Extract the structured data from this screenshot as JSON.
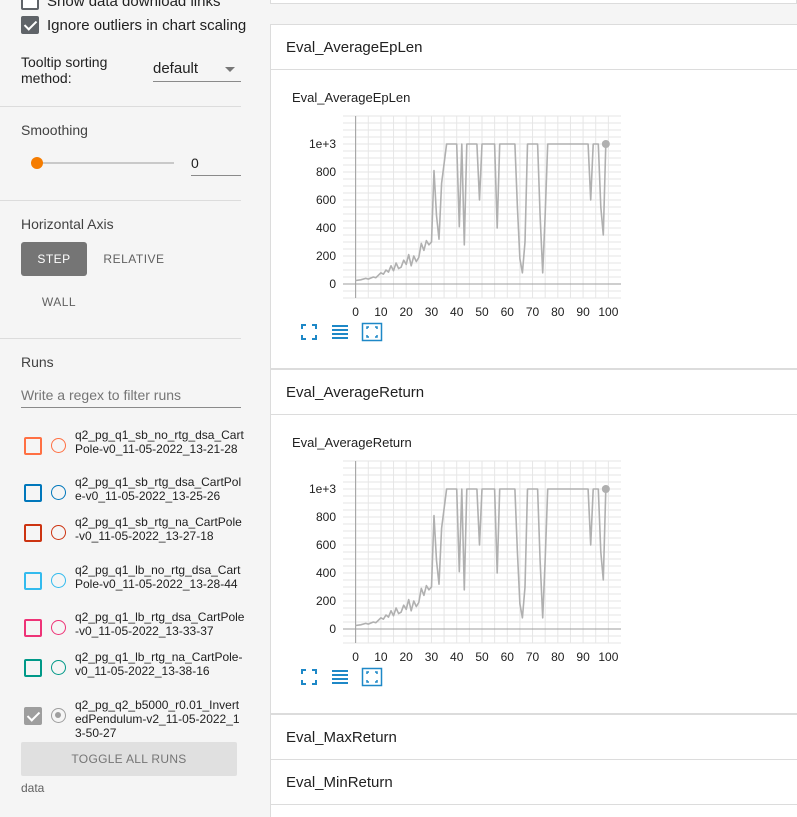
{
  "sidebar": {
    "show_download_links": "Show data download links",
    "ignore_outliers": "Ignore outliers in chart scaling",
    "tooltip_label": "Tooltip sorting method:",
    "tooltip_value": "default",
    "smoothing_title": "Smoothing",
    "smoothing_value": "0",
    "smoothing_level": 0,
    "haxis_title": "Horizontal Axis",
    "haxis_step": "STEP",
    "haxis_relative": "RELATIVE",
    "haxis_wall": "WALL",
    "haxis_selected": "STEP",
    "runs_title": "Runs",
    "runs_filter_placeholder": "Write a regex to filter runs",
    "runs": [
      {
        "name": "q2_pg_q1_sb_no_rtg_dsa_CartPole-v0_11-05-2022_13-21-28",
        "color": "#ff7043",
        "checked": false
      },
      {
        "name": "q2_pg_q1_sb_rtg_dsa_CartPole-v0_11-05-2022_13-25-26",
        "color": "#0077bb",
        "checked": false
      },
      {
        "name": "q2_pg_q1_sb_rtg_na_CartPole-v0_11-05-2022_13-27-18",
        "color": "#cc3311",
        "checked": false
      },
      {
        "name": "q2_pg_q1_lb_no_rtg_dsa_CartPole-v0_11-05-2022_13-28-44",
        "color": "#33bbee",
        "checked": false
      },
      {
        "name": "q2_pg_q1_lb_rtg_dsa_CartPole-v0_11-05-2022_13-33-37",
        "color": "#ee3377",
        "checked": false
      },
      {
        "name": "q2_pg_q1_lb_rtg_na_CartPole-v0_11-05-2022_13-38-16",
        "color": "#009988",
        "checked": false
      },
      {
        "name": "q2_pg_q2_b5000_r0.01_InvertedPendulum-v2_11-05-2022_13-50-27",
        "color": "#9e9e9e",
        "checked": true
      }
    ],
    "toggle_all": "TOGGLE ALL RUNS",
    "data_label": "data"
  },
  "main": {
    "sections": [
      "Eval_AverageEpLen",
      "Eval_AverageReturn",
      "Eval_MaxReturn",
      "Eval_MinReturn"
    ],
    "colors": {
      "accent": "#f57c00",
      "icon": "#1e88c7",
      "line": "#b0b0b0"
    }
  },
  "chart_data": [
    {
      "type": "line",
      "title": "Eval_AverageEpLen",
      "xlabel": "",
      "ylabel": "",
      "x_ticks": [
        "0",
        "10",
        "20",
        "30",
        "40",
        "50",
        "60",
        "70",
        "80",
        "90",
        "100"
      ],
      "y_ticks": [
        "0",
        "200",
        "400",
        "600",
        "800",
        "1e+3"
      ],
      "xlim": [
        -5,
        105
      ],
      "ylim": [
        -100,
        1200
      ],
      "grid": true,
      "series": [
        {
          "color": "#b0b0b0",
          "x": [
            0,
            2,
            4,
            5,
            7,
            8,
            10,
            11,
            12,
            13,
            14,
            15,
            16,
            17,
            18,
            19,
            20,
            21,
            22,
            23,
            24,
            25,
            26,
            27,
            28,
            29,
            30,
            31,
            32,
            33,
            34,
            36,
            38,
            39,
            40,
            41,
            42,
            43,
            44,
            45,
            46,
            47,
            48,
            49,
            50,
            51,
            52,
            53,
            54,
            55,
            56,
            57,
            58,
            59,
            60,
            61,
            62,
            63,
            64,
            65,
            66,
            67,
            68,
            69,
            70,
            71,
            72,
            73,
            74,
            75,
            76,
            78,
            80,
            82,
            84,
            86,
            88,
            90,
            91,
            92,
            93,
            94,
            95,
            96,
            97,
            98,
            99
          ],
          "y": [
            25,
            30,
            40,
            35,
            50,
            45,
            80,
            70,
            100,
            85,
            130,
            95,
            150,
            110,
            120,
            170,
            140,
            210,
            130,
            200,
            160,
            190,
            290,
            240,
            310,
            280,
            300,
            810,
            490,
            320,
            720,
            1000,
            1000,
            1000,
            1000,
            410,
            1000,
            280,
            1000,
            1000,
            1000,
            1000,
            1000,
            600,
            1000,
            1000,
            1000,
            1000,
            1000,
            1000,
            400,
            1000,
            1000,
            1000,
            1000,
            1000,
            1000,
            1000,
            550,
            180,
            80,
            300,
            1000,
            1000,
            1000,
            1000,
            1000,
            490,
            80,
            500,
            1000,
            1000,
            1000,
            1000,
            1000,
            1000,
            1000,
            1000,
            1000,
            1000,
            600,
            1000,
            1000,
            1000,
            550,
            350,
            1000
          ]
        }
      ]
    },
    {
      "type": "line",
      "title": "Eval_AverageReturn",
      "xlabel": "",
      "ylabel": "",
      "x_ticks": [
        "0",
        "10",
        "20",
        "30",
        "40",
        "50",
        "60",
        "70",
        "80",
        "90",
        "100"
      ],
      "y_ticks": [
        "0",
        "200",
        "400",
        "600",
        "800",
        "1e+3"
      ],
      "xlim": [
        -5,
        105
      ],
      "ylim": [
        -100,
        1200
      ],
      "grid": true,
      "series": [
        {
          "color": "#b0b0b0",
          "x": [
            0,
            2,
            4,
            5,
            7,
            8,
            10,
            11,
            12,
            13,
            14,
            15,
            16,
            17,
            18,
            19,
            20,
            21,
            22,
            23,
            24,
            25,
            26,
            27,
            28,
            29,
            30,
            31,
            32,
            33,
            34,
            36,
            38,
            39,
            40,
            41,
            42,
            43,
            44,
            45,
            46,
            47,
            48,
            49,
            50,
            51,
            52,
            53,
            54,
            55,
            56,
            57,
            58,
            59,
            60,
            61,
            62,
            63,
            64,
            65,
            66,
            67,
            68,
            69,
            70,
            71,
            72,
            73,
            74,
            75,
            76,
            78,
            80,
            82,
            84,
            86,
            88,
            90,
            91,
            92,
            93,
            94,
            95,
            96,
            97,
            98,
            99
          ],
          "y": [
            25,
            30,
            40,
            35,
            50,
            45,
            80,
            70,
            100,
            85,
            130,
            95,
            150,
            110,
            120,
            170,
            140,
            210,
            130,
            200,
            160,
            190,
            290,
            240,
            310,
            280,
            300,
            810,
            490,
            320,
            720,
            1000,
            1000,
            1000,
            1000,
            410,
            1000,
            280,
            1000,
            1000,
            1000,
            1000,
            1000,
            600,
            1000,
            1000,
            1000,
            1000,
            1000,
            1000,
            400,
            1000,
            1000,
            1000,
            1000,
            1000,
            1000,
            1000,
            550,
            180,
            80,
            300,
            1000,
            1000,
            1000,
            1000,
            1000,
            490,
            80,
            500,
            1000,
            1000,
            1000,
            1000,
            1000,
            1000,
            1000,
            1000,
            1000,
            1000,
            600,
            1000,
            1000,
            1000,
            550,
            350,
            1000
          ]
        }
      ]
    }
  ]
}
